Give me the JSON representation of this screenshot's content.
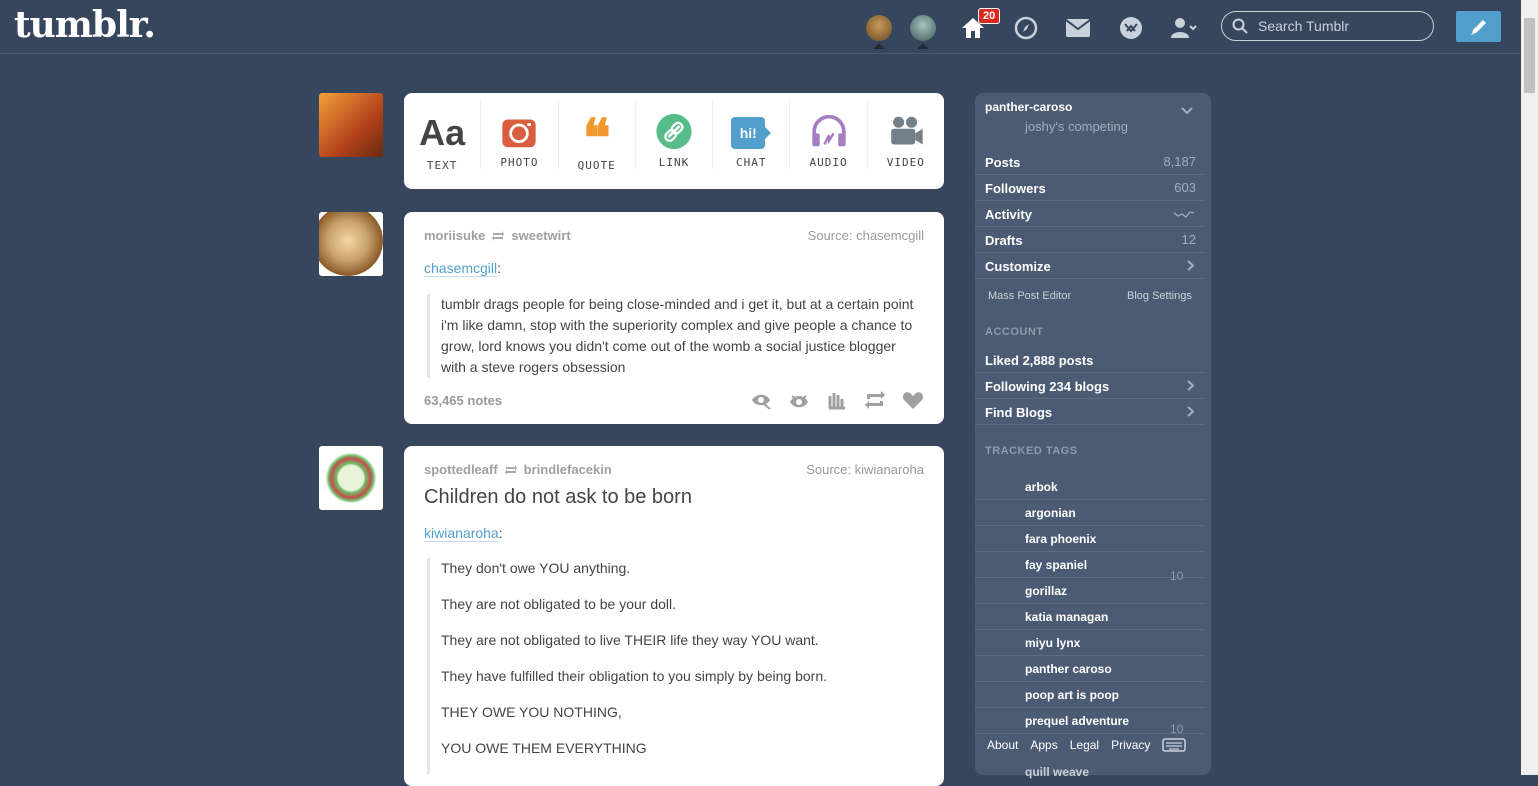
{
  "header": {
    "logo": "tumblr.",
    "inbox_count": "20",
    "search_placeholder": "Search Tumblr"
  },
  "composer": {
    "types": [
      {
        "label": "TEXT",
        "glyph": "Aa",
        "color": "#444444"
      },
      {
        "label": "PHOTO",
        "color": "#d95e40"
      },
      {
        "label": "QUOTE",
        "glyph": "❝",
        "color": "#f2992e"
      },
      {
        "label": "LINK",
        "color": "#56bc8a"
      },
      {
        "label": "CHAT",
        "glyph": "hi!",
        "color": "#529ecc"
      },
      {
        "label": "AUDIO",
        "color": "#a77dc2"
      },
      {
        "label": "VIDEO",
        "color": "#748089"
      }
    ]
  },
  "posts": [
    {
      "author": "moriisuke",
      "reblogged_from": "sweetwirt",
      "source": "Source: chasemcgill",
      "quoted_user": "chasemcgill",
      "body": "tumblr drags people for being close-minded and i get it, but at a certain point i'm like damn, stop with the superiority complex and give people a chance to grow, lord knows you didn't come out of the womb a social justice blogger with a steve rogers obsession",
      "notes": "63,465 notes"
    },
    {
      "author": "spottedleaff",
      "reblogged_from": "brindlefacekin",
      "source": "Source: kiwianaroha",
      "title": "Children do not ask to be born",
      "quoted_user": "kiwianaroha",
      "paragraphs": [
        "They don't owe YOU anything.",
        "They are not obligated to be your doll.",
        "They are not obligated to live THEIR life they way YOU want.",
        "They have fulfilled their obligation to you simply by being born.",
        "THEY OWE YOU NOTHING,",
        "YOU OWE THEM EVERYTHING"
      ]
    }
  ],
  "sidebar": {
    "blog_name": "panther-caroso",
    "blog_title": "joshy's competing",
    "stats": [
      {
        "label": "Posts",
        "value": "8,187"
      },
      {
        "label": "Followers",
        "value": "603"
      },
      {
        "label": "Activity",
        "value": ""
      },
      {
        "label": "Drafts",
        "value": "12"
      },
      {
        "label": "Customize",
        "value": ""
      }
    ],
    "mass_post_editor": "Mass Post Editor",
    "blog_settings": "Blog Settings",
    "account_heading": "ACCOUNT",
    "account": [
      {
        "label": "Liked 2,888 posts"
      },
      {
        "label": "Following 234 blogs"
      },
      {
        "label": "Find Blogs"
      }
    ],
    "tracked_heading": "TRACKED TAGS",
    "tags": [
      "arbok",
      "argonian",
      "fara phoenix",
      "fay spaniel",
      "gorillaz",
      "katia managan",
      "miyu lynx",
      "panther caroso",
      "poop art is poop",
      "prequel adventure"
    ],
    "tag_count_a": "10",
    "tag_count_b": "10",
    "partial_tag": "quill weave",
    "footer": {
      "about": "About",
      "apps": "Apps",
      "legal": "Legal",
      "privacy": "Privacy"
    }
  }
}
